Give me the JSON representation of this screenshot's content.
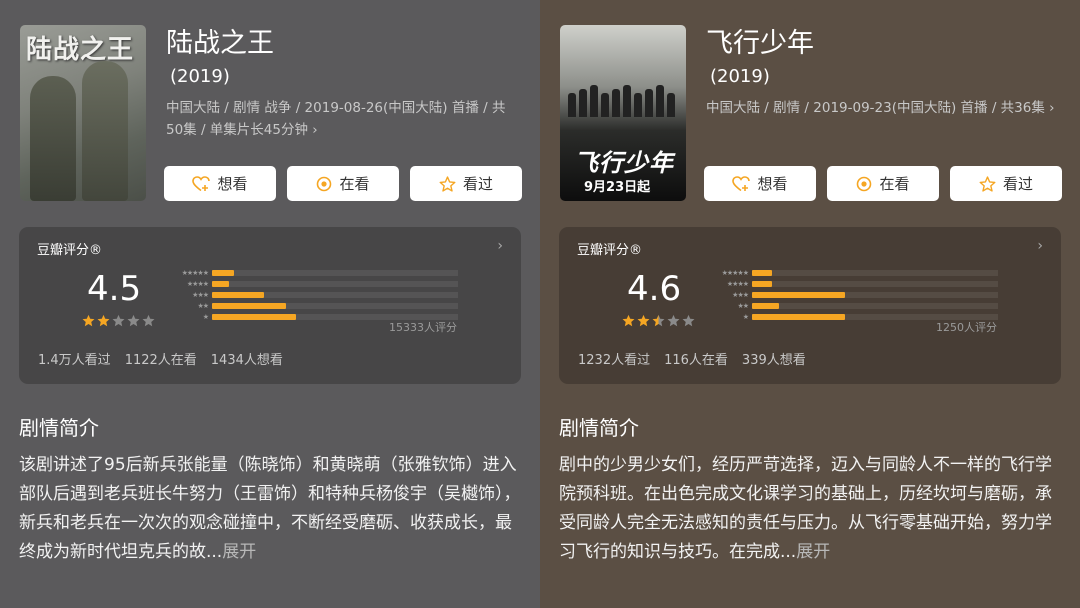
{
  "colors": {
    "accent": "#f5a623",
    "left_bg": "#5b5a5c",
    "right_bg": "#5b4f44",
    "star_empty": "#8a8a8a"
  },
  "shows": [
    {
      "poster_text": "陆战之王",
      "title": "陆战之王",
      "year": "(2019)",
      "meta": "中国大陆 / 剧情 战争 / 2019-08-26(中国大陆) 首播 / 共50集 / 单集片长45分钟",
      "meta_arrow": "›",
      "buttons": {
        "want": "想看",
        "watching": "在看",
        "watched": "看过"
      },
      "rating_label": "豆瓣评分®",
      "rating_arrow": "›",
      "score": "4.5",
      "star_value": 2.0,
      "distribution": [
        0.09,
        0.07,
        0.21,
        0.3,
        0.34
      ],
      "rating_count": "15333人评分",
      "stats": [
        "1.4万人看过",
        "1122人在看",
        "1434人想看"
      ],
      "plot_heading": "剧情简介",
      "plot": "该剧讲述了95后新兵张能量（陈晓饰）和黄晓萌（张雅钦饰）进入部队后遇到老兵班长牛努力（王雷饰）和特种兵杨俊宇（吴樾饰），新兵和老兵在一次次的观念碰撞中，不断经受磨砺、收获成长，最终成为新时代坦克兵的故...",
      "more": "展开"
    },
    {
      "poster_text": "飞行少年",
      "poster_date": "9月23日起",
      "title": "飞行少年",
      "year": "(2019)",
      "meta": "中国大陆 / 剧情 / 2019-09-23(中国大陆) 首播 / 共36集",
      "meta_arrow": "›",
      "buttons": {
        "want": "想看",
        "watching": "在看",
        "watched": "看过"
      },
      "rating_label": "豆瓣评分®",
      "rating_arrow": "›",
      "score": "4.6",
      "star_value": 2.5,
      "distribution": [
        0.08,
        0.08,
        0.38,
        0.11,
        0.38
      ],
      "rating_count": "1250人评分",
      "stats": [
        "1232人看过",
        "116人在看",
        "339人想看"
      ],
      "plot_heading": "剧情简介",
      "plot": "剧中的少男少女们，经历严苛选择，迈入与同龄人不一样的飞行学院预科班。在出色完成文化课学习的基础上，历经坎坷与磨砺，承受同龄人完全无法感知的责任与压力。从飞行零基础开始，努力学习飞行的知识与技巧。在完成...",
      "more": "展开"
    }
  ]
}
